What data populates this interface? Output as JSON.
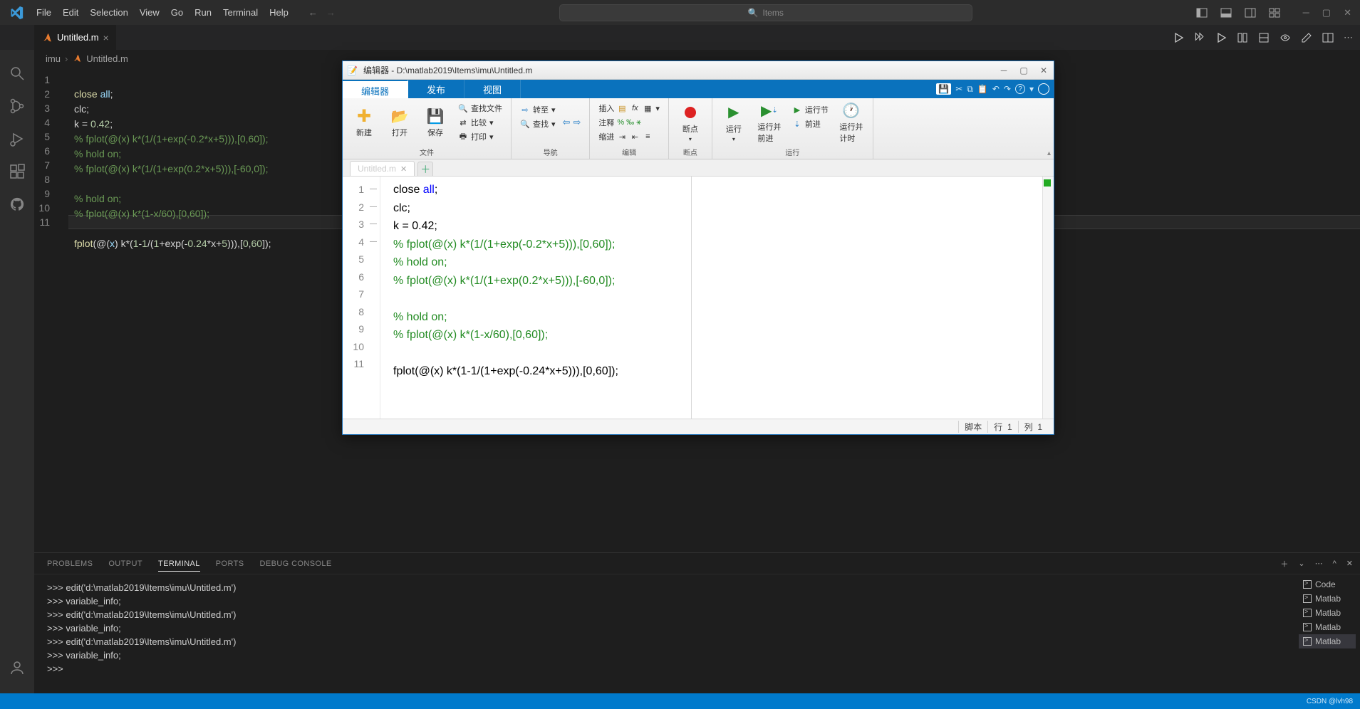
{
  "menu": {
    "file": "File",
    "edit": "Edit",
    "selection": "Selection",
    "view": "View",
    "go": "Go",
    "run": "Run",
    "terminal": "Terminal",
    "help": "Help"
  },
  "search_placeholder": "Items",
  "tab": {
    "title": "Untitled.m"
  },
  "breadcrumb": {
    "p0": "imu",
    "p1": "Untitled.m"
  },
  "code": {
    "l1a": "close",
    "l1b": " all",
    "l1c": ";",
    "l2": "clc;",
    "l3a": "k = ",
    "l3b": "0.42",
    "l3c": ";",
    "l4": "% fplot(@(x) k*(1/(1+exp(-0.2*x+5))),[0,60]);",
    "l5": "% hold on;",
    "l6": "% fplot(@(x) k*(1/(1+exp(0.2*x+5))),[-60,0]);",
    "l7": "",
    "l8": "% hold on;",
    "l9": "% fplot(@(x) k*(1-x/60),[0,60]);",
    "l10": "",
    "l11a": "fplot",
    "l11b": "(@(",
    "l11c": "x",
    "l11d": ") k*(",
    "l11e": "1",
    "l11f": "-",
    "l11g": "1",
    "l11h": "/(",
    "l11i": "1",
    "l11j": "+exp(-",
    "l11k": "0.24",
    "l11l": "*x+",
    "l11m": "5",
    "l11n": "))),[",
    "l11o": "0",
    "l11p": ",",
    "l11q": "60",
    "l11r": "]);"
  },
  "lines": [
    "1",
    "2",
    "3",
    "4",
    "5",
    "6",
    "7",
    "8",
    "9",
    "10",
    "11"
  ],
  "panel": {
    "problems": "PROBLEMS",
    "output": "OUTPUT",
    "terminal": "TERMINAL",
    "ports": "PORTS",
    "debug": "DEBUG CONSOLE"
  },
  "terminal": {
    "l1": ">>> edit('d:\\matlab2019\\Items\\imu\\Untitled.m')",
    "l2": ">>> variable_info;",
    "l3": ">>> edit('d:\\matlab2019\\Items\\imu\\Untitled.m')",
    "l4": ">>> variable_info;",
    "l5": ">>> edit('d:\\matlab2019\\Items\\imu\\Untitled.m')",
    "l6": ">>> variable_info;",
    "l7": ">>> "
  },
  "term_list": {
    "i1": "Code",
    "i2": "Matlab",
    "i3": "Matlab",
    "i4": "Matlab",
    "i5": "Matlab"
  },
  "watermark": "CSDN @lvh98",
  "ml": {
    "title": "编辑器 - D:\\matlab2019\\Items\\imu\\Untitled.m",
    "tabs": {
      "editor": "编辑器",
      "publish": "发布",
      "view": "视图"
    },
    "group": {
      "file": "文件",
      "nav": "导航",
      "edit": "编辑",
      "bp": "断点",
      "run": "运行"
    },
    "btn": {
      "new": "新建",
      "open": "打开",
      "save": "保存",
      "findfile": "查找文件",
      "compare": "比较",
      "print": "打印",
      "goto": "转至",
      "find": "查找",
      "insert": "插入",
      "comment": "注释",
      "indent": "缩进",
      "bp": "断点",
      "run": "运行",
      "runadv": "运行并\n前进",
      "runsec": "运行节",
      "advance": "前进",
      "runtime": "运行并\n计时",
      "fx": "fx"
    },
    "commentSyms": "%  ‰  ⚹",
    "filetab": "Untitled.m",
    "code": {
      "l1a": "close ",
      "l1b": "all",
      "l1c": ";",
      "l2": "clc;",
      "l3": "k = 0.42;",
      "l4": "% fplot(@(x) k*(1/(1+exp(-0.2*x+5))),[0,60]);",
      "l5": "% hold on;",
      "l6": "% fplot(@(x) k*(1/(1+exp(0.2*x+5))),[-60,0]);",
      "l7": "",
      "l8": "% hold on;",
      "l9": "% fplot(@(x) k*(1-x/60),[0,60]);",
      "l10": "",
      "l11": "fplot(@(x) k*(1-1/(1+exp(-0.24*x+5))),[0,60]);"
    },
    "status": {
      "script": "脚本",
      "row": "行",
      "rown": "1",
      "col": "列",
      "coln": "1"
    }
  }
}
